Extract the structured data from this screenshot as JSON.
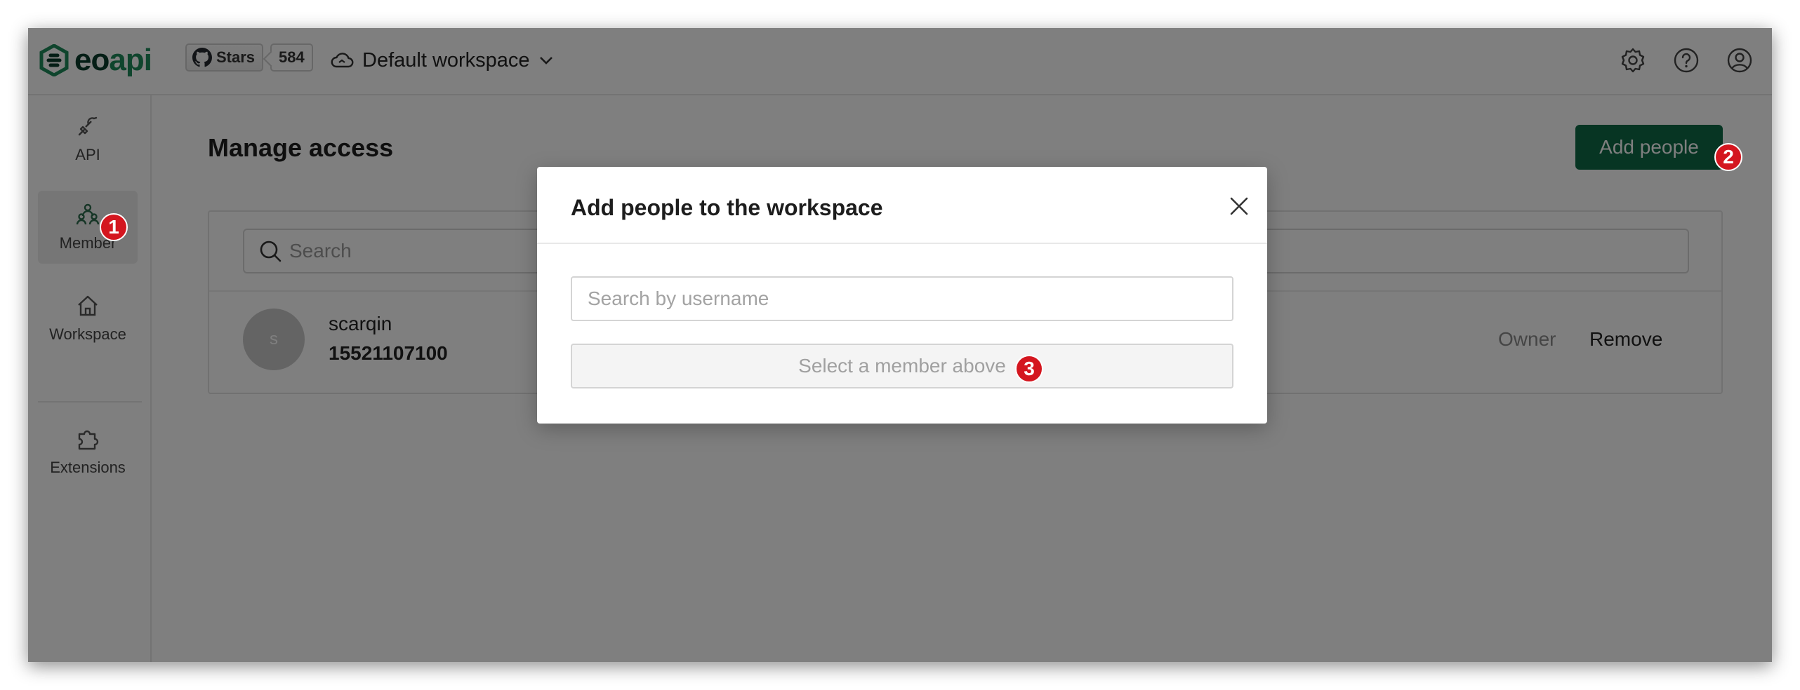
{
  "header": {
    "logo": {
      "part1": "eo",
      "part2": "api",
      "icon": "eoapi-logo-icon"
    },
    "github": {
      "label": "Stars",
      "count": "584",
      "icon": "github-icon"
    },
    "workspace": {
      "name": "Default workspace",
      "icon": "cloud-icon"
    },
    "icons": [
      "settings-icon",
      "help-icon",
      "user-account-icon"
    ]
  },
  "sidebar": {
    "items": [
      {
        "label": "API",
        "icon": "plug-icon"
      },
      {
        "label": "Member",
        "icon": "members-icon",
        "active": true
      },
      {
        "label": "Workspace",
        "icon": "home-icon"
      },
      {
        "label": "Extensions",
        "icon": "puzzle-icon"
      }
    ]
  },
  "main": {
    "title": "Manage access",
    "add_button": "Add people",
    "search": {
      "placeholder": "Search"
    },
    "members": [
      {
        "avatar": "s",
        "name": "scarqin",
        "phone": "15521107100",
        "role": "Owner",
        "action": "Remove"
      }
    ]
  },
  "modal": {
    "title": "Add people to the workspace",
    "input_placeholder": "Search by username",
    "select_button": "Select a member above"
  },
  "markers": [
    "1",
    "2",
    "3"
  ],
  "colors": {
    "brand_green": "#0f6b47",
    "logo_dark": "#0b3d2c",
    "logo_light": "#1f8a5b",
    "marker_red": "#d4161f",
    "overlay": "rgba(0,0,0,0.5)"
  }
}
